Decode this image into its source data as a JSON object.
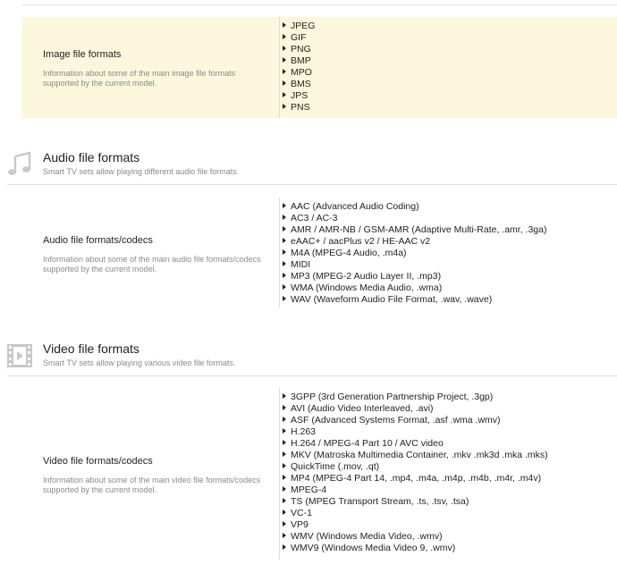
{
  "image_formats": {
    "title": "Image file formats",
    "description": "Information about some of the main image file formats supported by the current model.",
    "items": [
      "JPEG",
      "GIF",
      "PNG",
      "BMP",
      "MPO",
      "BMS",
      "JPS",
      "PNS"
    ]
  },
  "audio_section": {
    "icon": "music-note-icon",
    "title": "Audio file formats",
    "subtitle": "Smart TV sets allow playing different audio file formats."
  },
  "audio_formats": {
    "title": "Audio file formats/codecs",
    "description": "Information about some of the main audio file formats/codecs supported by the current model.",
    "items": [
      "AAC (Advanced Audio Coding)",
      "AC3 / AC-3",
      "AMR / AMR-NB / GSM-AMR (Adaptive Multi-Rate, .amr, .3ga)",
      "eAAC+ / aacPlus v2 / HE-AAC v2",
      "M4A (MPEG-4 Audio, .m4a)",
      "MIDI",
      "MP3 (MPEG-2 Audio Layer II, .mp3)",
      "WMA (Windows Media Audio, .wma)",
      "WAV (Waveform Audio File Format, .wav, .wave)"
    ]
  },
  "video_section": {
    "icon": "film-strip-icon",
    "title": "Video file formats",
    "subtitle": "Smart TV sets allow playing various video file formats."
  },
  "video_formats": {
    "title": "Video file formats/codecs",
    "description": "Information about some of the main video file formats/codecs supported by the current model.",
    "items": [
      "3GPP (3rd Generation Partnership Project, .3gp)",
      "AVI (Audio Video Interleaved, .avi)",
      "ASF (Advanced Systems Format, .asf .wma .wmv)",
      "H.263",
      "H.264 / MPEG-4 Part 10 / AVC video",
      "MKV (Matroska Multimedia Container, .mkv .mk3d .mka .mks)",
      "QuickTime (.mov, .qt)",
      "MP4 (MPEG-4 Part 14, .mp4, .m4a, .m4p, .m4b, .m4r, .m4v)",
      "MPEG-4",
      "TS (MPEG Transport Stream, .ts, .tsv, .tsa)",
      "VC-1",
      "VP9",
      "WMV (Windows Media Video, .wmv)",
      "WMV9 (Windows Media Video 9, .wmv)"
    ]
  },
  "colors": {
    "highlight_row": "#fcf6dc",
    "icon_gray": "#c8c8c8",
    "divider": "#dcdcdc"
  }
}
